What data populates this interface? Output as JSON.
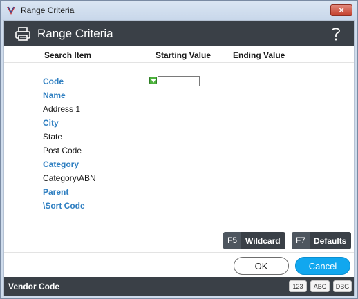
{
  "window": {
    "title": "Range Criteria",
    "close_label": "✕"
  },
  "header": {
    "title": "Range Criteria"
  },
  "columns": {
    "search_item": "Search Item",
    "starting_value": "Starting Value",
    "ending_value": "Ending Value"
  },
  "rows": [
    {
      "label": "Code",
      "link": true
    },
    {
      "label": "Name",
      "link": true
    },
    {
      "label": "Address 1",
      "link": false
    },
    {
      "label": "City",
      "link": true
    },
    {
      "label": "State",
      "link": false
    },
    {
      "label": "Post Code",
      "link": false
    },
    {
      "label": "Category",
      "link": true
    },
    {
      "label": "Category\\ABN",
      "link": false
    },
    {
      "label": "Parent",
      "link": true
    },
    {
      "label": "\\Sort Code",
      "link": true
    }
  ],
  "code_start_value": "",
  "fkeys": {
    "wildcard": {
      "key": "F5",
      "label": "Wildcard"
    },
    "defaults": {
      "key": "F7",
      "label": "Defaults"
    }
  },
  "buttons": {
    "ok": "OK",
    "cancel": "Cancel"
  },
  "status": {
    "text": "Vendor Code",
    "indicators": [
      "123",
      "ABC",
      "DBG"
    ]
  },
  "colors": {
    "accent": "#11a7ef",
    "link": "#2f7fc1",
    "dark_bar": "#3a4047",
    "filter": "#4db33d"
  },
  "icons": {
    "app": "app-logo-icon",
    "print": "printer-icon",
    "help": "help-question-icon",
    "filter": "filter-dropdown-icon"
  }
}
